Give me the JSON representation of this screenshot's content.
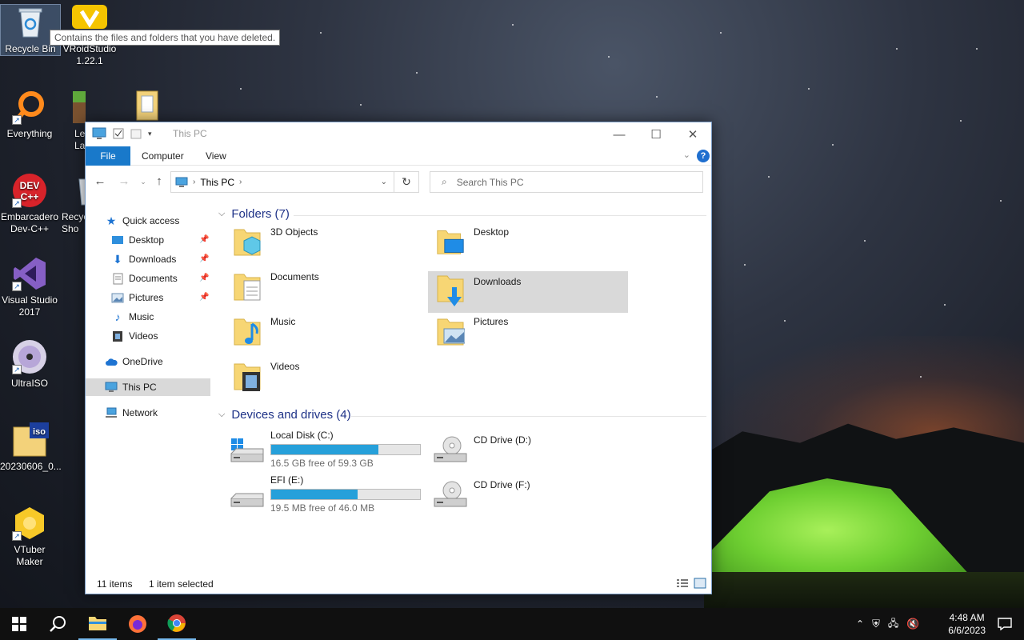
{
  "desktop": {
    "tooltip": "Contains the files and folders that you have deleted.",
    "icons": [
      {
        "label": "Recycle Bin"
      },
      {
        "label": "VRoidStudio 1.22.1"
      },
      {
        "label": "Everything"
      },
      {
        "label": "Le Lau"
      },
      {
        "label": "Embarcadero Dev-C++"
      },
      {
        "label": "Recyc Sho"
      },
      {
        "label": "Visual Studio 2017"
      },
      {
        "label": "UltraISO"
      },
      {
        "label": "20230606_0..."
      },
      {
        "label": "VTuber Maker"
      }
    ]
  },
  "window": {
    "title": "This PC",
    "ribbon_tabs": [
      "File",
      "Computer",
      "View"
    ],
    "help_label": "?",
    "address": {
      "location": "This PC"
    },
    "search": {
      "placeholder": "Search This PC"
    },
    "nav": {
      "quick_access": "Quick access",
      "items": [
        {
          "label": "Desktop",
          "pinned": true
        },
        {
          "label": "Downloads",
          "pinned": true
        },
        {
          "label": "Documents",
          "pinned": true
        },
        {
          "label": "Pictures",
          "pinned": true
        },
        {
          "label": "Music",
          "pinned": false
        },
        {
          "label": "Videos",
          "pinned": false
        }
      ],
      "onedrive": "OneDrive",
      "this_pc": "This PC",
      "network": "Network"
    },
    "folders_header": "Folders (7)",
    "folders": [
      {
        "label": "3D Objects",
        "icon": "3d-objects-folder-icon"
      },
      {
        "label": "Desktop",
        "icon": "desktop-folder-icon"
      },
      {
        "label": "Documents",
        "icon": "documents-folder-icon"
      },
      {
        "label": "Downloads",
        "icon": "downloads-folder-icon",
        "selected": true
      },
      {
        "label": "Music",
        "icon": "music-folder-icon"
      },
      {
        "label": "Pictures",
        "icon": "pictures-folder-icon"
      },
      {
        "label": "Videos",
        "icon": "videos-folder-icon"
      }
    ],
    "drives_header": "Devices and drives (4)",
    "drives": [
      {
        "label": "Local Disk (C:)",
        "free": "16.5 GB free of 59.3 GB",
        "used_fraction": 0.72
      },
      {
        "label": "CD Drive (D:)"
      },
      {
        "label": "EFI (E:)",
        "free": "19.5 MB free of 46.0 MB",
        "used_fraction": 0.58
      },
      {
        "label": "CD Drive (F:)"
      }
    ],
    "status": {
      "items": "11 items",
      "selected": "1 item selected"
    }
  },
  "taskbar": {
    "time": "4:48 AM",
    "date": "6/6/2023"
  },
  "colors": {
    "accent": "#1979ca",
    "drive_bar": "#26a0da",
    "selection": "#d9d9d9",
    "group_header": "#1e3287"
  }
}
